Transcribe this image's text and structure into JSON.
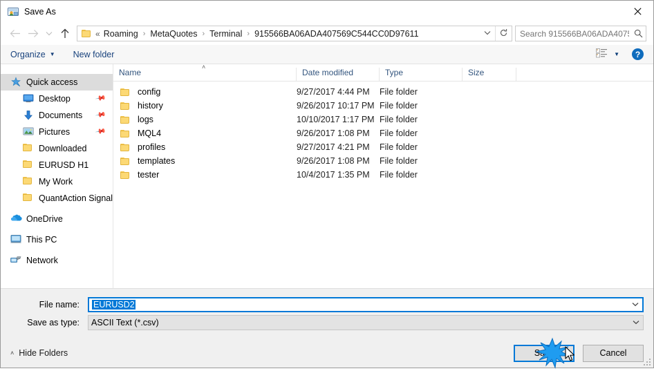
{
  "window": {
    "title": "Save As",
    "title_icon": "save-as-icon",
    "close_icon": "close-icon"
  },
  "nav": {
    "back_icon": "arrow-left-icon",
    "forward_icon": "arrow-right-icon",
    "recent_icon": "chevron-down-icon",
    "up_icon": "arrow-up-icon",
    "breadcrumb_lead": "«",
    "breadcrumb": [
      "Roaming",
      "MetaQuotes",
      "Terminal",
      "915566BA06ADA407569C544CC0D97611"
    ],
    "breadcrumb_separator": "›",
    "dropdown_icon": "chevron-down-icon",
    "refresh_icon": "refresh-icon"
  },
  "search": {
    "placeholder": "Search 915566BA06ADA40756...",
    "value": "",
    "icon": "search-icon"
  },
  "toolbar": {
    "organize_label": "Organize",
    "organize_caret": "▼",
    "new_folder_label": "New folder",
    "view_icon": "view-layout-icon",
    "view_caret": "▼",
    "help_label": "?",
    "help_icon": "help-icon"
  },
  "sidebar": {
    "items": [
      {
        "label": "Quick access",
        "icon": "star-pin-icon",
        "level": "root",
        "selected": true,
        "pinned": false
      },
      {
        "label": "Desktop",
        "icon": "desktop-icon",
        "level": "child",
        "selected": false,
        "pinned": true
      },
      {
        "label": "Documents",
        "icon": "documents-download-icon",
        "level": "child",
        "selected": false,
        "pinned": true
      },
      {
        "label": "Pictures",
        "icon": "pictures-icon",
        "level": "child",
        "selected": false,
        "pinned": true
      },
      {
        "label": "Downloaded",
        "icon": "folder-icon",
        "level": "child",
        "selected": false,
        "pinned": false
      },
      {
        "label": "EURUSD H1",
        "icon": "folder-icon",
        "level": "child",
        "selected": false,
        "pinned": false
      },
      {
        "label": "My Work",
        "icon": "folder-icon",
        "level": "child",
        "selected": false,
        "pinned": false
      },
      {
        "label": "QuantAction Signal",
        "icon": "folder-icon",
        "level": "child",
        "selected": false,
        "pinned": false
      },
      {
        "label": "OneDrive",
        "icon": "onedrive-cloud-icon",
        "level": "root",
        "selected": false,
        "pinned": false
      },
      {
        "label": "This PC",
        "icon": "this-pc-icon",
        "level": "root",
        "selected": false,
        "pinned": false
      },
      {
        "label": "Network",
        "icon": "network-icon",
        "level": "root",
        "selected": false,
        "pinned": false
      }
    ]
  },
  "filelist": {
    "columns": [
      "Name",
      "Date modified",
      "Type",
      "Size"
    ],
    "sort_indicator": "˄",
    "rows": [
      {
        "name": "config",
        "date": "9/27/2017 4:44 PM",
        "type": "File folder",
        "size": ""
      },
      {
        "name": "history",
        "date": "9/26/2017 10:17 PM",
        "type": "File folder",
        "size": ""
      },
      {
        "name": "logs",
        "date": "10/10/2017 1:17 PM",
        "type": "File folder",
        "size": ""
      },
      {
        "name": "MQL4",
        "date": "9/26/2017 1:08 PM",
        "type": "File folder",
        "size": ""
      },
      {
        "name": "profiles",
        "date": "9/27/2017 4:21 PM",
        "type": "File folder",
        "size": ""
      },
      {
        "name": "templates",
        "date": "9/26/2017 1:08 PM",
        "type": "File folder",
        "size": ""
      },
      {
        "name": "tester",
        "date": "10/4/2017 1:35 PM",
        "type": "File folder",
        "size": ""
      }
    ]
  },
  "form": {
    "file_name_label": "File name:",
    "file_name_value": "EURUSD2",
    "save_as_type_label": "Save as type:",
    "save_as_type_value": "ASCII Text (*.csv)",
    "dropdown_icon": "chevron-down-icon"
  },
  "footer": {
    "hide_folders_label": "Hide Folders",
    "hide_folders_caret": "˄",
    "save_label": "Save",
    "cancel_label": "Cancel"
  },
  "colors": {
    "accent": "#0078d7",
    "folder": "#fcd975",
    "column_header_text": "#33557e",
    "toolbar_link": "#18427c",
    "selection": "#dcdcdc"
  }
}
